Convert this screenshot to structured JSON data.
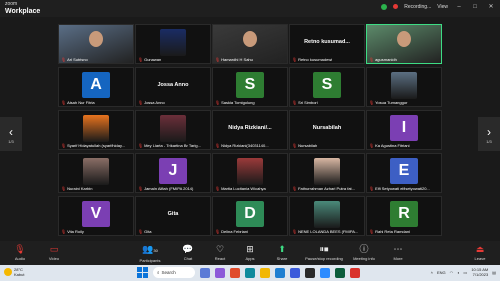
{
  "app": {
    "brand_small": "zoom",
    "brand": "Workplace",
    "recording": "Recording...",
    "view": "View"
  },
  "tiles": [
    {
      "name": "Ari Sutrisno",
      "type": "video",
      "bg": "#5a6e86",
      "active": false
    },
    {
      "name": "Gunawan",
      "type": "photo",
      "bg": "#1a2c64",
      "active": false
    },
    {
      "name": "Hamardhi H Sahu",
      "type": "video",
      "bg": "#3a3a3a",
      "active": false
    },
    {
      "name": "Retno kusumadewi",
      "big": "Retno kusumad...",
      "type": "text",
      "active": false
    },
    {
      "name": "agusmanidh",
      "type": "video",
      "bg": "#5c8a6a",
      "active": true
    },
    {
      "name": "Aisah Nur Fitria",
      "letter": "A",
      "type": "letter",
      "bg": "#1565c0",
      "active": false
    },
    {
      "name": "Jossa Anno",
      "big": "Jossa Anno",
      "type": "text",
      "active": false
    },
    {
      "name": "Saskia Tomigolung",
      "letter": "S",
      "type": "letter",
      "bg": "#2e7d32",
      "active": false
    },
    {
      "name": "Sri Simbori",
      "letter": "S",
      "type": "letter",
      "bg": "#2e7d32",
      "active": false
    },
    {
      "name": "Yosua Tumanggor",
      "type": "photo",
      "bg": "#5b6f82",
      "active": false
    },
    {
      "name": "Syarif Hidayatullah (syarifhiday...",
      "type": "photo",
      "bg": "#e8731e",
      "active": false
    },
    {
      "name": "Mey Liarta - Trikartina Br Tarig...",
      "type": "photo",
      "bg": "#6b2f3a",
      "active": false
    },
    {
      "name": "Nidya Rizkiani(34031140...",
      "big": "Nidya Rizkiani/...",
      "type": "text",
      "active": false
    },
    {
      "name": "Nursabilah",
      "big": "Nursabilah",
      "type": "text",
      "active": false
    },
    {
      "name": "Ka Agustina Fitriani",
      "letter": "I",
      "type": "letter",
      "bg": "#7b3fb3",
      "active": false
    },
    {
      "name": "Nuraini Karbin",
      "type": "photo",
      "bg": "#8a6e66",
      "active": false
    },
    {
      "name": "Jamaln Alfiah (FMIPA 2014)",
      "letter": "J",
      "type": "letter",
      "bg": "#7b3fb3",
      "active": false
    },
    {
      "name": "Martia Lucitania Wicahya",
      "type": "photo",
      "bg": "#9b3a3a",
      "active": false
    },
    {
      "name": "Fathurrahman Azhari Putra fat...",
      "type": "photo",
      "bg": "#d8b7a3",
      "active": false
    },
    {
      "name": "Elfi Setyowati elfisetyowati20...",
      "letter": "E",
      "type": "letter",
      "bg": "#3d5fc4",
      "active": false
    },
    {
      "name": "Vita Roily",
      "letter": "V",
      "type": "letter",
      "bg": "#7b3fb3",
      "active": false
    },
    {
      "name": "Gita",
      "big": "Gita",
      "type": "text",
      "active": false
    },
    {
      "name": "Delina Febriani",
      "letter": "D",
      "type": "letter",
      "bg": "#2e8b57",
      "active": false
    },
    {
      "name": "NENE LOLANDA BEES (FMIPA...",
      "type": "photo",
      "bg": "#4a8a7a",
      "active": false
    },
    {
      "name": "Rahi Reta Ramdani",
      "letter": "R",
      "type": "letter",
      "bg": "#2e7d32",
      "active": false
    }
  ],
  "pager": {
    "left": "1/3",
    "right": "1/3"
  },
  "toolbar": {
    "audio": "Audio",
    "video": "Video",
    "participants": "Participants",
    "participants_count": "30",
    "chat": "Chat",
    "react": "React",
    "apps": "Apps",
    "share": "Share",
    "record": "Pause/stop recording",
    "meeting_info": "Meeting info",
    "more": "More",
    "leave": "Leave"
  },
  "taskbar": {
    "temp": "28°C",
    "weather": "Kabut",
    "search": "Search",
    "lang": "ENG",
    "time": "10:15 AM",
    "date": "7/1/2023"
  }
}
